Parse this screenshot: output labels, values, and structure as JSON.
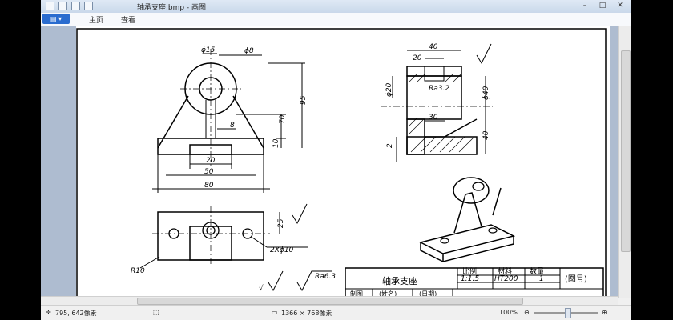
{
  "window": {
    "title": "轴承支座.bmp - 画图",
    "minimize": "–",
    "maximize": "□",
    "close": "✕"
  },
  "ribbon": {
    "app_button": "▤ ▾",
    "tabs": [
      "主页",
      "查看"
    ]
  },
  "drawing": {
    "front_view": {
      "dims": [
        "ϕ15",
        "ϕ8",
        "95",
        "70",
        "10",
        "8",
        "20",
        "50",
        "80"
      ]
    },
    "side_view": {
      "dims": [
        "40",
        "20",
        "ϕ20",
        "Ra3.2",
        "ϕ40",
        "30",
        "2",
        "40"
      ]
    },
    "top_view": {
      "dims": [
        "25",
        "2Xϕ10",
        "R10"
      ]
    },
    "roughness_note": {
      "a": "√",
      "b": "Ra6.3"
    },
    "title_block": {
      "part_name": "轴承支座",
      "headers": [
        "比例",
        "材料",
        "数量"
      ],
      "values": [
        "1:1.5",
        "HT200",
        "1"
      ],
      "drawing_no": "(图号)",
      "row2": [
        "制图",
        "(姓名)",
        "(日期)"
      ]
    }
  },
  "status": {
    "cursor_pos": "795, 642像素",
    "image_size": "1366 × 768像素",
    "zoom": "100%"
  }
}
